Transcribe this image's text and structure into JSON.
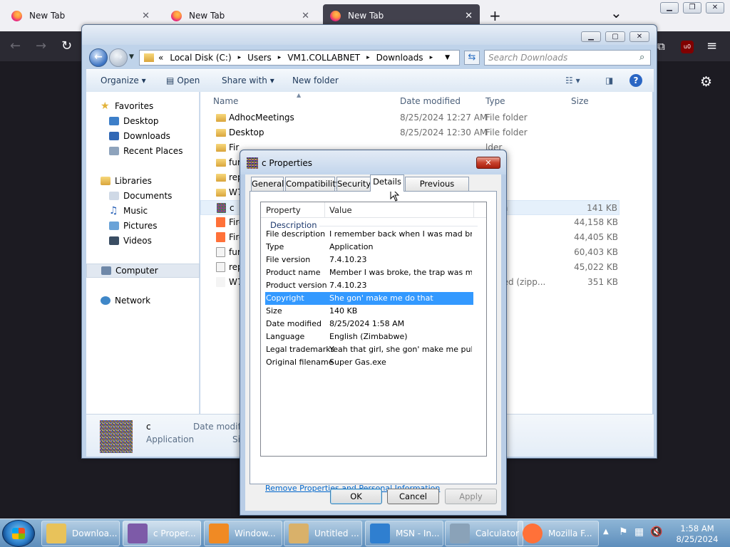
{
  "firefox": {
    "tabs": [
      {
        "title": "New Tab"
      },
      {
        "title": "New Tab"
      },
      {
        "title": "New Tab",
        "active": true
      }
    ],
    "new_tab_glyph": "+",
    "list_tabs_glyph": "⌄",
    "ublock_badge": "u0"
  },
  "explorer": {
    "breadcrumb": [
      "Local Disk (C:)",
      "Users",
      "VM1.COLLABNET",
      "Downloads"
    ],
    "breadcrumb_prefix": "«",
    "search_placeholder": "Search Downloads",
    "commands": {
      "organize": "Organize",
      "open": "Open",
      "share": "Share with",
      "new_folder": "New folder"
    },
    "nav": {
      "favorites": "Favorites",
      "desktop": "Desktop",
      "downloads": "Downloads",
      "recent": "Recent Places",
      "libraries": "Libraries",
      "documents": "Documents",
      "music": "Music",
      "pictures": "Pictures",
      "videos": "Videos",
      "computer": "Computer",
      "network": "Network"
    },
    "columns": {
      "name": "Name",
      "date": "Date modified",
      "type": "Type",
      "size": "Size"
    },
    "files": [
      {
        "name": "AdhocMeetings",
        "date": "8/25/2024 12:27 AM",
        "type": "File folder",
        "size": ""
      },
      {
        "name": "Desktop",
        "date": "8/25/2024 12:30 AM",
        "type": "File folder",
        "size": ""
      },
      {
        "name": "Fir",
        "date": "",
        "type": "lder",
        "size": ""
      },
      {
        "name": "fur",
        "date": "",
        "type": "lder",
        "size": ""
      },
      {
        "name": "rep",
        "date": "",
        "type": "lder",
        "size": ""
      },
      {
        "name": "W7",
        "date": "",
        "type": "lder",
        "size": ""
      },
      {
        "name": "c",
        "date": "",
        "type": "ation",
        "size": "141 KB"
      },
      {
        "name": "Fire",
        "date": "",
        "type": "ation",
        "size": "44,158 KB"
      },
      {
        "name": "Fire",
        "date": "",
        "type": "ation",
        "size": "44,405 KB"
      },
      {
        "name": "fur",
        "date": "",
        "type": "e",
        "size": "60,403 KB"
      },
      {
        "name": "rep",
        "date": "",
        "type": "e",
        "size": "45,022 KB"
      },
      {
        "name": "W7",
        "date": "",
        "type": "ressed (zipp...",
        "size": "351 KB"
      }
    ],
    "details": {
      "name": "c",
      "type": "Application",
      "date_label": "Date modifie",
      "size_label": "Siz"
    }
  },
  "dialog": {
    "title": "c Properties",
    "close_glyph": "✕",
    "tabs": [
      "General",
      "Compatibility",
      "Security",
      "Details",
      "Previous Versions"
    ],
    "header": {
      "property": "Property",
      "value": "Value"
    },
    "section": "Description",
    "properties": [
      {
        "key": "File description",
        "value": "I remember back when I was mad broke"
      },
      {
        "key": "Type",
        "value": "Application"
      },
      {
        "key": "File version",
        "value": "7.4.10.23"
      },
      {
        "key": "Product name",
        "value": "Member I was broke, the trap was mad ..."
      },
      {
        "key": "Product version",
        "value": "7.4.10.23"
      },
      {
        "key": "Copyright",
        "value": "She gon' make me do that"
      },
      {
        "key": "Size",
        "value": "140 KB"
      },
      {
        "key": "Date modified",
        "value": "8/25/2024 1:58 AM"
      },
      {
        "key": "Language",
        "value": "English (Zimbabwe)"
      },
      {
        "key": "Legal trademarks",
        "value": "Yeah that girl, she gon' make me pull by"
      },
      {
        "key": "Original filename",
        "value": "Super Gas.exe"
      }
    ],
    "remove_link": "Remove Properties and Personal Information",
    "buttons": {
      "ok": "OK",
      "cancel": "Cancel",
      "apply": "Apply"
    }
  },
  "taskbar": {
    "items": [
      {
        "label": "Downloa...",
        "icon_color": "#e8c25a"
      },
      {
        "label": "c Proper...",
        "icon_color": "#7d5aa8"
      },
      {
        "label": "Window...",
        "icon_color": "#f08a24"
      },
      {
        "label": "Untitled ...",
        "icon_color": "#d9b16a"
      },
      {
        "label": "MSN - In...",
        "icon_color": "#2f7fd0"
      },
      {
        "label": "Calculator",
        "icon_color": "#8aa2b8"
      },
      {
        "label": "Mozilla F...",
        "icon_color": "#ff7139"
      }
    ],
    "time": "1:58 AM",
    "date": "8/25/2024"
  }
}
